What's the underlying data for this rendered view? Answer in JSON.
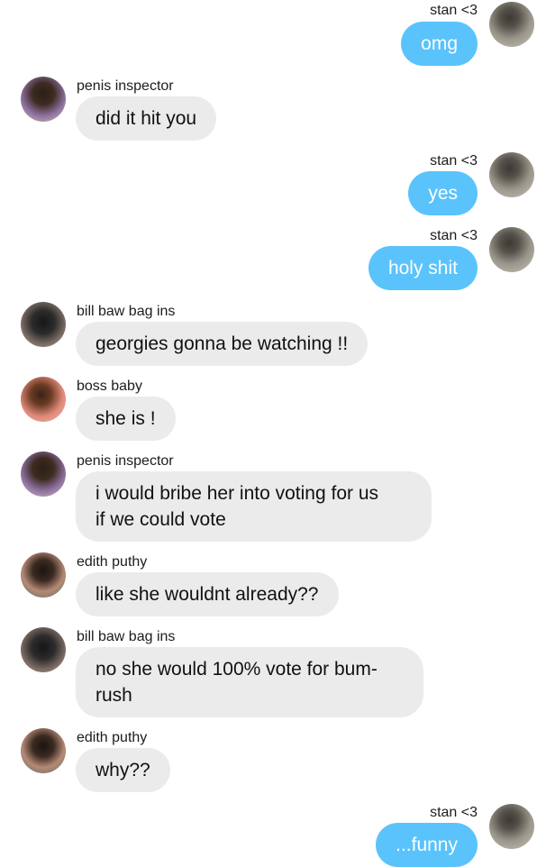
{
  "messages": [
    {
      "direction": "outgoing",
      "sender": "stan <3",
      "text": "omg",
      "avatar": "stan-avatar"
    },
    {
      "direction": "incoming",
      "sender": "penis inspector",
      "text": "did it hit you",
      "avatar": "penis-inspector-avatar"
    },
    {
      "direction": "outgoing",
      "sender": "stan <3",
      "text": "yes",
      "avatar": "stan-avatar"
    },
    {
      "direction": "outgoing",
      "sender": "stan <3",
      "text": "holy shit",
      "avatar": "stan-avatar"
    },
    {
      "direction": "incoming",
      "sender": "bill baw bag ins",
      "text": "georgies gonna be watching !!",
      "avatar": "bill-avatar"
    },
    {
      "direction": "incoming",
      "sender": "boss baby",
      "text": "she is !",
      "avatar": "boss-baby-avatar"
    },
    {
      "direction": "incoming",
      "sender": "penis inspector",
      "text_lines": [
        "i would bribe her into voting for us",
        "if we could vote"
      ],
      "avatar": "penis-inspector-avatar"
    },
    {
      "direction": "incoming",
      "sender": "edith puthy",
      "text": "like she wouldnt already??",
      "avatar": "edith-avatar"
    },
    {
      "direction": "incoming",
      "sender": "bill baw bag ins",
      "text_lines": [
        "no she would 100% vote for bum-",
        "rush"
      ],
      "avatar": "bill-avatar"
    },
    {
      "direction": "incoming",
      "sender": "edith puthy",
      "text": "why??",
      "avatar": "edith-avatar"
    },
    {
      "direction": "outgoing",
      "sender": "stan <3",
      "text": "...funny",
      "avatar": "stan-avatar"
    }
  ],
  "colors": {
    "outgoing_bubble": "#5ac3fb",
    "incoming_bubble": "#ebebeb"
  }
}
